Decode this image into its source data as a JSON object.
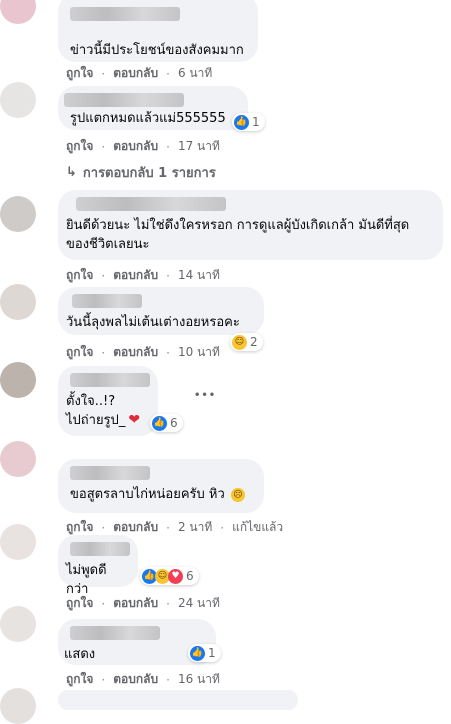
{
  "comments": [
    {
      "text": "ข่าวนี้มีประโยชน์ของสังคมมาก",
      "like": "ถูกใจ",
      "reply": "ตอบกลับ",
      "time": "6 นาที"
    },
    {
      "text": "รูปแตกหมดแล้วแม่555555",
      "like": "ถูกใจ",
      "reply": "ตอบกลับ",
      "time": "17 นาที",
      "reaction_count": "1"
    },
    {
      "text": "ยินดีด้วยนะ ไม่ใช่ดึงใครหรอก การดูแลผู้บังเกิดเกล้า มันดีที่สุดของชีวิตเลยนะ",
      "like": "ถูกใจ",
      "reply": "ตอบกลับ",
      "time": "14 นาที"
    },
    {
      "text": "วันนี้ลุงพลไม่เต้นเต่างอยหรอคะ",
      "like": "ถูกใจ",
      "reply": "ตอบกลับ",
      "time": "10 นาที",
      "reaction_count": "2"
    },
    {
      "text1": "ตั้งใจ..!?",
      "text2": "ไปถ่ายรูป_",
      "more": "•••",
      "reaction_count": "6"
    },
    {
      "text": "ขอสูตรลาบไก่หน่อยครับ หิว",
      "like": "ถูกใจ",
      "reply": "ตอบกลับ",
      "time": "2 นาที",
      "edited": "แก้ไขแล้ว"
    },
    {
      "text": "ไม่พูดดีกว่า",
      "like": "ถูกใจ",
      "reply": "ตอบกลับ",
      "time": "24 นาที",
      "reaction_count": "6"
    },
    {
      "text": "แสดง",
      "like": "ถูกใจ",
      "reply": "ตอบกลับ",
      "time": "16 นาที",
      "reaction_count": "1"
    }
  ],
  "replies_link": "การตอบกลับ 1 รายการ",
  "separator": "·",
  "icons": {
    "like": "like-icon",
    "haha": "haha-icon",
    "love": "love-icon",
    "reply_arrow": "reply-arrow-icon"
  },
  "colors": {
    "bubble": "#f0f2f5",
    "meta": "#65676b",
    "like_blue": "#1877f2"
  }
}
